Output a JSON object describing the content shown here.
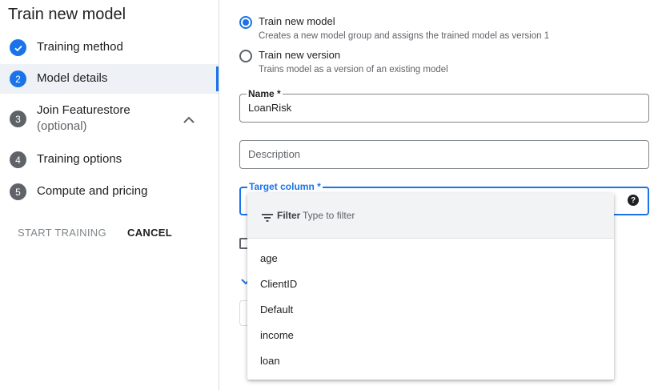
{
  "sidebar": {
    "title": "Train new model",
    "steps": [
      {
        "number": "",
        "label": "Training method",
        "sublabel": "",
        "status": "complete"
      },
      {
        "number": "2",
        "label": "Model details",
        "sublabel": "",
        "status": "active"
      },
      {
        "number": "3",
        "label": "Join Featurestore",
        "sublabel": "(optional)",
        "status": "pending"
      },
      {
        "number": "4",
        "label": "Training options",
        "sublabel": "",
        "status": "pending"
      },
      {
        "number": "5",
        "label": "Compute and pricing",
        "sublabel": "",
        "status": "pending"
      }
    ],
    "start_training_label": "START TRAINING",
    "cancel_label": "CANCEL"
  },
  "form": {
    "radio_options": [
      {
        "label": "Train new model",
        "description": "Creates a new model group and assigns the trained model as version 1",
        "selected": true
      },
      {
        "label": "Train new version",
        "description": "Trains model as a version of an existing model",
        "selected": false
      }
    ],
    "name_field": {
      "label": "Name *",
      "value": "LoanRisk"
    },
    "description_field": {
      "placeholder": "Description"
    },
    "target_column_field": {
      "label": "Target column *",
      "value": ""
    }
  },
  "dropdown": {
    "filter_label": "Filter",
    "filter_placeholder": "Type to filter",
    "options": [
      "age",
      "ClientID",
      "Default",
      "income",
      "loan"
    ]
  },
  "colors": {
    "accent": "#1a73e8",
    "active_step_bg": "#eef1f6",
    "step_badge_grey": "#5f6368",
    "filter_bar_bg": "#f1f3f4"
  }
}
